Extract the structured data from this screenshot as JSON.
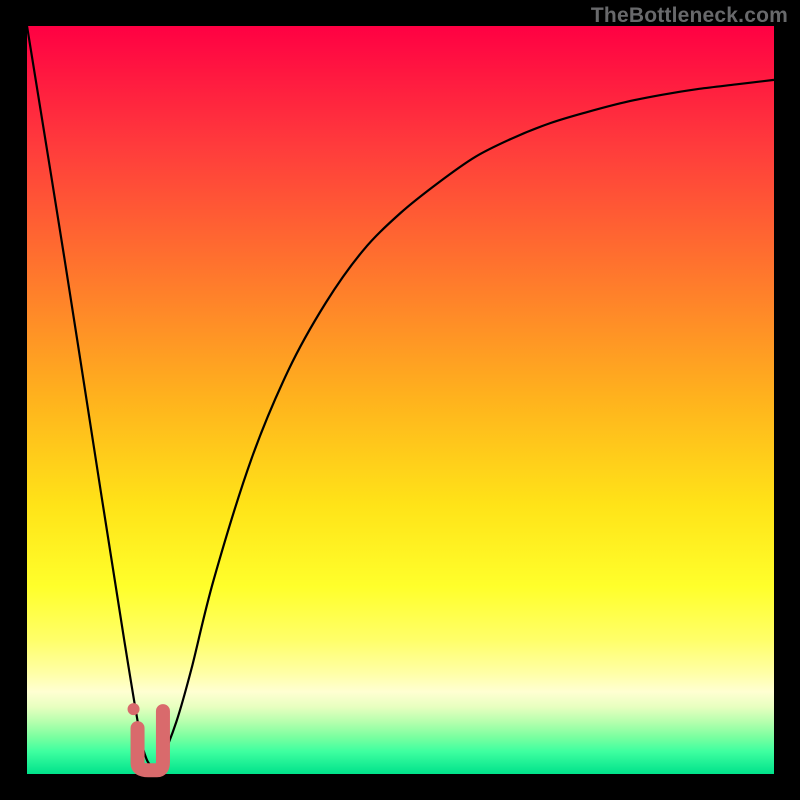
{
  "watermark": "TheBottleneck.com",
  "colors": {
    "background": "#000000",
    "curve": "#000000",
    "marker": "#d96a6c",
    "gradient_top": "#ff0043",
    "gradient_bottom": "#00e28b"
  },
  "chart_data": {
    "type": "line",
    "title": "",
    "xlabel": "",
    "ylabel": "",
    "xlim": [
      0,
      100
    ],
    "ylim": [
      0,
      100
    ],
    "series": [
      {
        "name": "bottleneck-curve",
        "x": [
          0,
          5,
          10,
          13,
          15,
          16,
          17,
          18,
          20,
          22,
          25,
          30,
          35,
          40,
          45,
          50,
          55,
          60,
          65,
          70,
          75,
          80,
          85,
          90,
          95,
          100
        ],
        "values": [
          100,
          69,
          37,
          18,
          6,
          2,
          1,
          2,
          7,
          14,
          26,
          42,
          54,
          63,
          70,
          75,
          79,
          82.5,
          85,
          87,
          88.5,
          89.8,
          90.8,
          91.6,
          92.2,
          92.8
        ]
      }
    ],
    "marker": {
      "name": "optimal-region",
      "x_range": [
        14.8,
        18.2
      ],
      "y_min": 0.5,
      "y_at_ends": 6
    }
  }
}
